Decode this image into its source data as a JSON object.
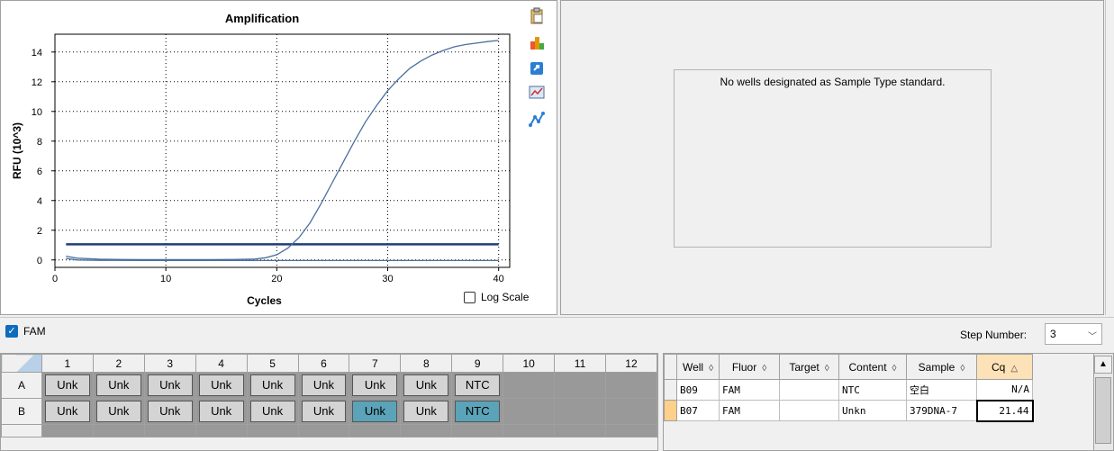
{
  "chart": {
    "title": "Amplification",
    "log_scale_label": "Log Scale",
    "log_scale_checked": false
  },
  "chart_data": {
    "type": "line",
    "title": "Amplification",
    "xlabel": "Cycles",
    "ylabel": "RFU (10^3)",
    "xlim": [
      0,
      41
    ],
    "ylim": [
      -0.5,
      15.2
    ],
    "x_ticks": [
      0,
      10,
      20,
      30,
      40
    ],
    "y_ticks": [
      0,
      2,
      4,
      6,
      8,
      10,
      12,
      14
    ],
    "grid": "dotted",
    "threshold": 1.05,
    "series": [
      {
        "color": "#4a6f9f",
        "x": [
          1,
          2,
          4,
          6,
          8,
          10,
          12,
          14,
          16,
          18,
          19,
          20,
          21,
          22,
          23,
          24,
          25,
          26,
          27,
          28,
          29,
          30,
          31,
          32,
          33,
          34,
          35,
          36,
          37,
          38,
          39,
          40
        ],
        "y": [
          0.25,
          0.12,
          0.05,
          0.03,
          0.02,
          0.02,
          0.02,
          0.02,
          0.03,
          0.06,
          0.15,
          0.35,
          0.8,
          1.5,
          2.5,
          3.8,
          5.2,
          6.6,
          8.0,
          9.3,
          10.4,
          11.4,
          12.2,
          12.9,
          13.4,
          13.8,
          14.1,
          14.35,
          14.5,
          14.6,
          14.7,
          14.78
        ]
      },
      {
        "color": "#4a6f9f",
        "x": [
          1,
          2,
          4,
          8,
          12,
          16,
          20,
          24,
          28,
          32,
          36,
          40
        ],
        "y": [
          0.1,
          0.0,
          -0.03,
          -0.04,
          -0.04,
          -0.04,
          -0.04,
          -0.04,
          -0.04,
          -0.04,
          -0.04,
          -0.04
        ]
      }
    ]
  },
  "right_panel": {
    "message": "No wells designated as Sample Type standard."
  },
  "filter": {
    "fam_label": "FAM",
    "fam_checked": true,
    "step_label": "Step Number:",
    "step_value": "3"
  },
  "plate": {
    "columns": [
      "1",
      "2",
      "3",
      "4",
      "5",
      "6",
      "7",
      "8",
      "9",
      "10",
      "11",
      "12"
    ],
    "rows": [
      {
        "label": "A",
        "wells": [
          "Unk",
          "Unk",
          "Unk",
          "Unk",
          "Unk",
          "Unk",
          "Unk",
          "Unk",
          "NTC",
          "",
          "",
          ""
        ],
        "selected": []
      },
      {
        "label": "B",
        "wells": [
          "Unk",
          "Unk",
          "Unk",
          "Unk",
          "Unk",
          "Unk",
          "Unk",
          "Unk",
          "NTC",
          "",
          "",
          ""
        ],
        "selected": [
          6,
          8
        ]
      }
    ]
  },
  "results": {
    "headers": [
      "Well",
      "Fluor",
      "Target",
      "Content",
      "Sample",
      "Cq"
    ],
    "sorted_column": "Cq",
    "rows": [
      {
        "well": "B09",
        "fluor": "FAM",
        "target": "",
        "content": "NTC",
        "sample": "空白",
        "cq": "N/A"
      },
      {
        "well": "B07",
        "fluor": "FAM",
        "target": "",
        "content": "Unkn",
        "sample": "379DNA-7",
        "cq": "21.44"
      }
    ]
  },
  "icons": [
    "clipboard-icon",
    "color-palette-icon",
    "export-icon",
    "chart-options-icon",
    "graph-icon"
  ]
}
